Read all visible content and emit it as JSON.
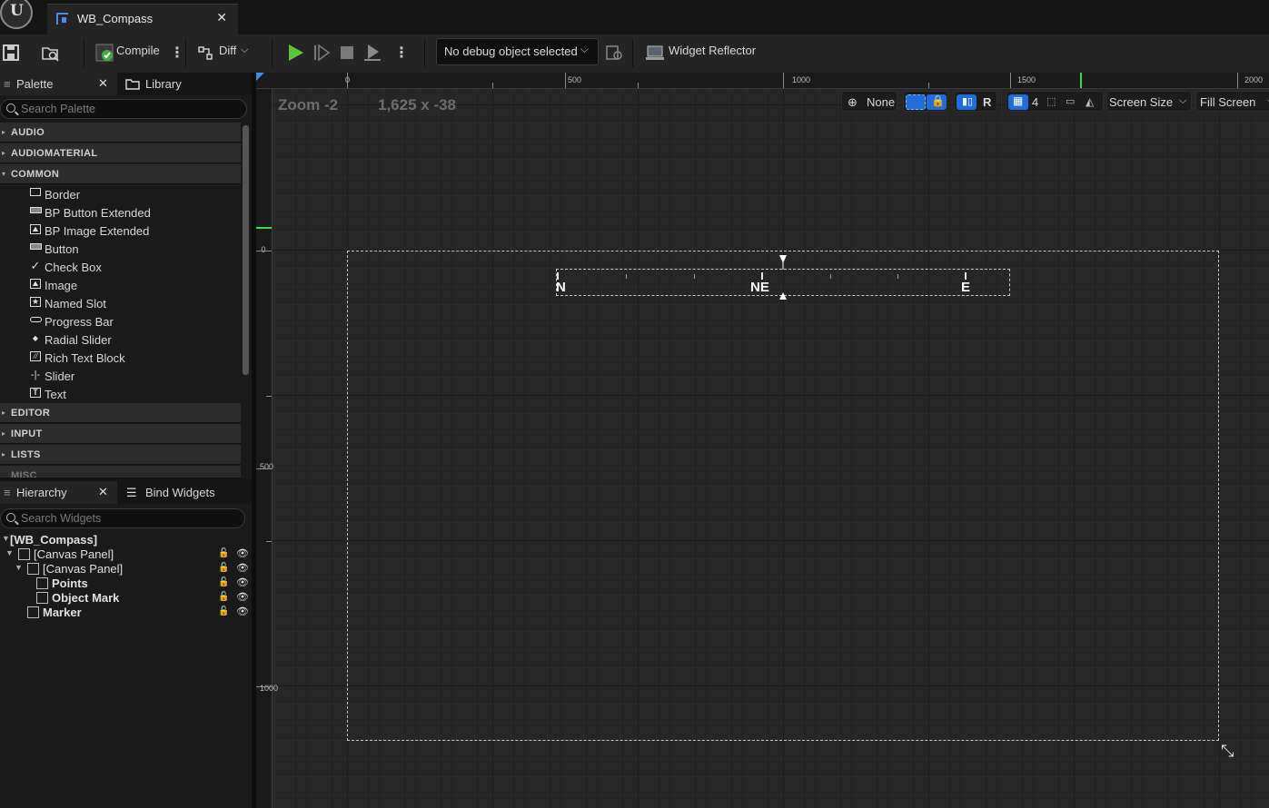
{
  "window": {
    "tab_title": "WB_Compass",
    "tab_close": "✕"
  },
  "toolbar": {
    "compile_label": "Compile",
    "diff_label": "Diff",
    "debug_object": "No debug object selected",
    "widget_reflector_label": "Widget Reflector"
  },
  "palette": {
    "tab_label": "Palette",
    "close": "✕",
    "library_tab_label": "Library",
    "search_placeholder": "Search Palette",
    "categories": {
      "audio": "AUDIO",
      "audiomaterial": "AUDIOMATERIAL",
      "common": "COMMON",
      "editor": "EDITOR",
      "input": "INPUT",
      "lists": "LISTS",
      "misc": "MISC"
    },
    "common_items": [
      {
        "label": "Border",
        "icon": "border-icon"
      },
      {
        "label": "BP Button Extended",
        "icon": "button-icon"
      },
      {
        "label": "BP Image Extended",
        "icon": "image-icon"
      },
      {
        "label": "Button",
        "icon": "button-icon"
      },
      {
        "label": "Check Box",
        "icon": "checkbox-icon"
      },
      {
        "label": "Image",
        "icon": "image-icon"
      },
      {
        "label": "Named Slot",
        "icon": "named-slot-icon"
      },
      {
        "label": "Progress Bar",
        "icon": "progress-bar-icon"
      },
      {
        "label": "Radial Slider",
        "icon": "radial-slider-icon"
      },
      {
        "label": "Rich Text Block",
        "icon": "rich-text-icon"
      },
      {
        "label": "Slider",
        "icon": "slider-icon"
      },
      {
        "label": "Text",
        "icon": "text-icon"
      }
    ]
  },
  "hierarchy": {
    "tab_label": "Hierarchy",
    "close": "✕",
    "bind_widgets_label": "Bind Widgets",
    "search_placeholder": "Search Widgets",
    "rows": [
      {
        "label": "[WB_Compass]"
      },
      {
        "label": "[Canvas Panel]"
      },
      {
        "label": "[Canvas Panel]"
      },
      {
        "label": "Points"
      },
      {
        "label": "Object Mark"
      },
      {
        "label": "Marker"
      }
    ]
  },
  "designer": {
    "zoom_label": "Zoom -2",
    "resolution_label": "1,625 x -38",
    "ruler_top": [
      "0",
      "500",
      "1000",
      "1500",
      "2000"
    ],
    "ruler_left": [
      "0",
      "500",
      "1000"
    ],
    "localization_label": "None",
    "r_button": "R",
    "grid_size": "4",
    "screen_size_label": "Screen Size",
    "fill_screen_label": "Fill Screen",
    "compass_labels": [
      "N",
      "NE",
      "E"
    ]
  },
  "colors": {
    "accent_blue": "#1e6dd8",
    "play_green": "#58c83a",
    "background": "#151515"
  }
}
